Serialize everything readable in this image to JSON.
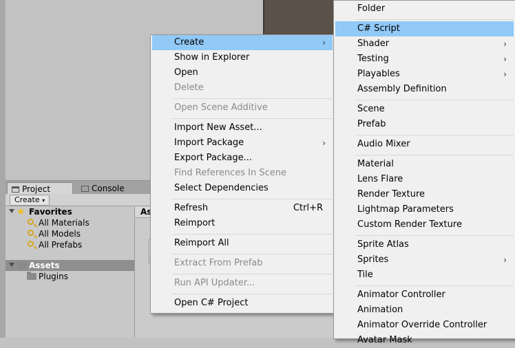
{
  "project_window": {
    "tabs": [
      {
        "label": "Project",
        "icon": "folder-icon"
      },
      {
        "label": "Console",
        "icon": "console-icon"
      }
    ],
    "create_label": "Create",
    "favorites": {
      "label": "Favorites",
      "items": [
        "All Materials",
        "All Models",
        "All Prefabs"
      ]
    },
    "assets": {
      "label": "Assets",
      "items": [
        "Plugins"
      ]
    },
    "content_header": "As"
  },
  "context_menu": {
    "items": [
      {
        "label": "Create",
        "submenu": true,
        "highlighted": true
      },
      {
        "label": "Show in Explorer"
      },
      {
        "label": "Open"
      },
      {
        "label": "Delete",
        "disabled": true
      },
      {
        "label": "Open Scene Additive",
        "disabled": true
      },
      {
        "label": "Import New Asset..."
      },
      {
        "label": "Import Package",
        "submenu": true
      },
      {
        "label": "Export Package..."
      },
      {
        "label": "Find References In Scene",
        "disabled": true
      },
      {
        "label": "Select Dependencies"
      },
      {
        "label": "Refresh",
        "shortcut": "Ctrl+R"
      },
      {
        "label": "Reimport"
      },
      {
        "label": "Reimport All"
      },
      {
        "label": "Extract From Prefab",
        "disabled": true
      },
      {
        "label": "Run API Updater...",
        "disabled": true
      },
      {
        "label": "Open C# Project"
      }
    ]
  },
  "create_submenu": {
    "items": [
      {
        "label": "Folder"
      },
      {
        "label": "C# Script",
        "highlighted": true
      },
      {
        "label": "Shader",
        "submenu": true
      },
      {
        "label": "Testing",
        "submenu": true
      },
      {
        "label": "Playables",
        "submenu": true
      },
      {
        "label": "Assembly Definition"
      },
      {
        "label": "Scene"
      },
      {
        "label": "Prefab"
      },
      {
        "label": "Audio Mixer"
      },
      {
        "label": "Material"
      },
      {
        "label": "Lens Flare"
      },
      {
        "label": "Render Texture"
      },
      {
        "label": "Lightmap Parameters"
      },
      {
        "label": "Custom Render Texture"
      },
      {
        "label": "Sprite Atlas"
      },
      {
        "label": "Sprites",
        "submenu": true
      },
      {
        "label": "Tile"
      },
      {
        "label": "Animator Controller"
      },
      {
        "label": "Animation"
      },
      {
        "label": "Animator Override Controller"
      },
      {
        "label": "Avatar Mask"
      }
    ]
  },
  "colors": {
    "highlight": "#91c9f7",
    "menu_bg": "#f0f0f0",
    "disabled_text": "#8a8a8a"
  }
}
